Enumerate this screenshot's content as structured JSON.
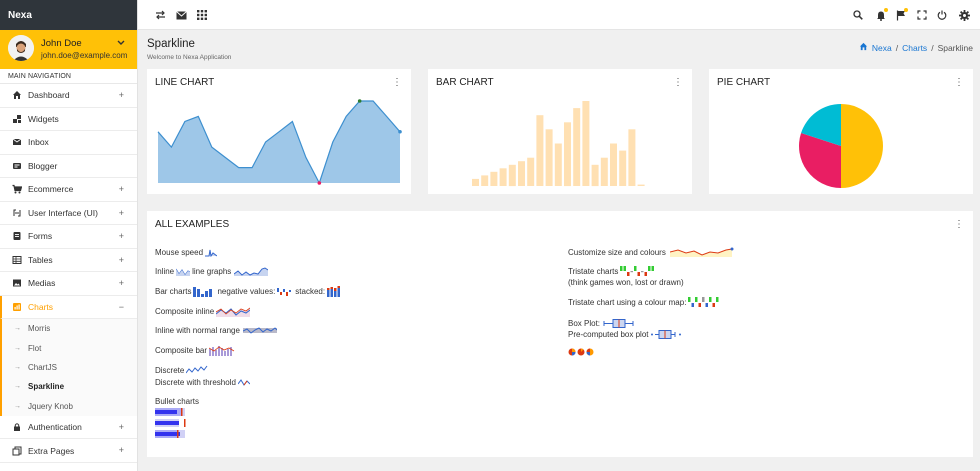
{
  "app": {
    "brand": "Nexa"
  },
  "user": {
    "name": "John Doe",
    "email": "john.doe@example.com"
  },
  "nav": {
    "title": "MAIN NAVIGATION",
    "items_top": [
      {
        "label": "Dashboard",
        "icon": "home-icon",
        "expandable": true
      },
      {
        "label": "Widgets",
        "icon": "widgets-icon",
        "expandable": false
      },
      {
        "label": "Inbox",
        "icon": "inbox-icon",
        "expandable": false
      },
      {
        "label": "Blogger",
        "icon": "blogger-icon",
        "expandable": false
      },
      {
        "label": "Ecommerce",
        "icon": "cart-icon",
        "expandable": true
      },
      {
        "label": "User Interface (UI)",
        "icon": "ui-icon",
        "expandable": true
      },
      {
        "label": "Forms",
        "icon": "forms-icon",
        "expandable": true
      },
      {
        "label": "Tables",
        "icon": "tables-icon",
        "expandable": true
      },
      {
        "label": "Medias",
        "icon": "media-icon",
        "expandable": true
      }
    ],
    "charts": {
      "label": "Charts",
      "icon": "chart-icon",
      "toggle": "−"
    },
    "sub_items": [
      {
        "label": "Morris"
      },
      {
        "label": "Flot"
      },
      {
        "label": "ChartJS"
      },
      {
        "label": "Sparkline",
        "current": true
      },
      {
        "label": "Jquery Knob"
      }
    ],
    "items_bottom": [
      {
        "label": "Authentication",
        "icon": "lock-icon",
        "expandable": true
      },
      {
        "label": "Extra Pages",
        "icon": "pages-icon",
        "expandable": true
      }
    ],
    "plus": "+"
  },
  "page": {
    "title": "Sparkline",
    "subtitle": "Welcome to Nexa Application"
  },
  "breadcrumb": {
    "home": "Nexa",
    "section": "Charts",
    "current": "Sparkline",
    "sep": "/"
  },
  "cards": {
    "line": {
      "title": "LINE CHART",
      "menu": "⋮"
    },
    "bar": {
      "title": "BAR CHART",
      "menu": "⋮"
    },
    "pie": {
      "title": "PIE CHART",
      "menu": "⋮"
    },
    "all": {
      "title": "ALL EXAMPLES",
      "menu": "⋮"
    }
  },
  "examples": {
    "mouse_speed": "Mouse speed",
    "inline": "Inline",
    "line_graphs": "line graphs",
    "bar_charts": "Bar charts",
    "negative_values": "negative values:",
    "stacked": "stacked:",
    "composite_inline": "Composite inline",
    "inline_normal_range": "Inline with normal range",
    "composite_bar": "Composite bar",
    "discrete": "Discrete",
    "discrete_threshold": "Discrete with threshold",
    "bullet_charts": "Bullet charts",
    "customize": "Customize size and colours",
    "tristate": "Tristate charts",
    "tristate_note": "(think games won, lost or drawn)",
    "tristate_map": "Tristate chart using a colour map:",
    "box_plot": "Box Plot:",
    "precomputed_box": "Pre-computed box plot"
  },
  "colors": {
    "accent": "#ffc107",
    "link": "#1976d2",
    "line_fill": "#9ec7e8",
    "line_stroke": "#3d8fcf",
    "bar": "#ffe0b2",
    "pie": [
      "#ffc107",
      "#e91e63",
      "#00bcd4"
    ]
  },
  "chart_data": [
    {
      "type": "area",
      "values": [
        5,
        3.5,
        6,
        6.5,
        3.5,
        2.5,
        1.5,
        1.5,
        4,
        5,
        6,
        2.5,
        0,
        4,
        6.5,
        8,
        8,
        6.5,
        5
      ],
      "ylim": [
        0,
        8
      ]
    },
    {
      "type": "bar",
      "values": [
        1,
        1.5,
        2,
        2.5,
        3,
        3.5,
        4,
        10,
        8,
        6,
        9,
        11,
        12,
        3,
        4,
        6,
        5,
        8,
        0.2
      ],
      "ylim": [
        0,
        12
      ]
    },
    {
      "type": "pie",
      "values": [
        50,
        30,
        20
      ]
    }
  ]
}
